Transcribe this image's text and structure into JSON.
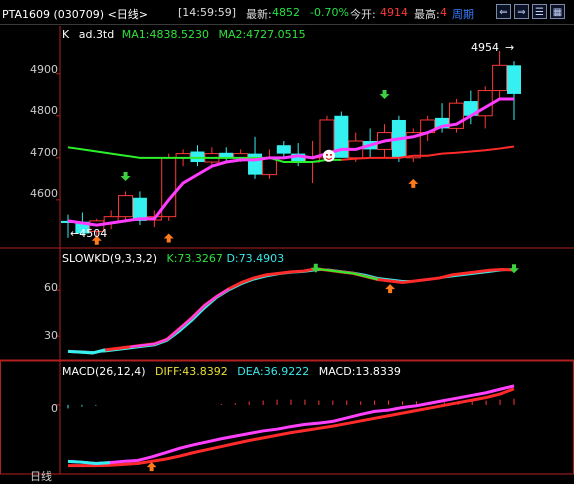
{
  "topbar": {
    "symbol": "PTA1609 (030709) <日线>",
    "clock": "[14:59:59]",
    "latest_label": "最新:",
    "latest_value": "4852",
    "change_pct": "-0.70%",
    "open_label": "今开:",
    "open_value": "4914",
    "high_label": "最高:",
    "high_value": "4",
    "cycle_label": "周期",
    "buttons": [
      {
        "name": "prev-button",
        "icon": "left-arrow-icon",
        "glyph": "⇐"
      },
      {
        "name": "next-button",
        "icon": "right-arrow-icon",
        "glyph": "⇒"
      },
      {
        "name": "list-button",
        "icon": "list-icon",
        "glyph": "☰"
      },
      {
        "name": "grid-button",
        "icon": "grid-icon",
        "glyph": "▦"
      }
    ]
  },
  "kline": {
    "header": {
      "prefix": "K",
      "name": "ad.3td",
      "ma1": "MA1:4838.5230",
      "ma2": "MA2:4727.0515"
    },
    "y_ticks": [
      "4900",
      "4800",
      "4700",
      "4600"
    ],
    "high_label": "4954",
    "low_label": "4504",
    "colors": {
      "up": "#ff3838",
      "down": "#34f0f0",
      "ma1": "#ff3cff",
      "ma2": "#2cf02c",
      "line": "#ff2a2a"
    }
  },
  "kd": {
    "header": {
      "name": "SLOWKD(9,3,3,2)",
      "k": "K:73.3267",
      "d": "D:73.4903"
    },
    "y_ticks": [
      "60",
      "30"
    ]
  },
  "macd": {
    "header": {
      "name": "MACD(26,12,4)",
      "diff": "DIFF:43.8392",
      "dea": "DEA:36.9222",
      "macd": "MACD:13.8339"
    },
    "y_ticks": [
      "0"
    ]
  },
  "bottom": {
    "period": "日线"
  },
  "chart_data": [
    {
      "type": "candlestick",
      "title": "PTA1609 K ad.3td",
      "ylim": [
        4495,
        4985
      ],
      "series": [
        {
          "name": "K",
          "ohlc": [
            [
              4550,
              4565,
              4510,
              4545
            ],
            [
              4548,
              4570,
              4515,
              4520
            ],
            [
              4525,
              4555,
              4505,
              4550
            ],
            [
              4545,
              4575,
              4530,
              4560
            ],
            [
              4560,
              4620,
              4550,
              4610
            ],
            [
              4605,
              4620,
              4540,
              4550
            ],
            [
              4552,
              4575,
              4535,
              4560
            ],
            [
              4560,
              4710,
              4550,
              4700
            ],
            [
              4700,
              4720,
              4680,
              4710
            ],
            [
              4715,
              4730,
              4680,
              4690
            ],
            [
              4690,
              4725,
              4680,
              4710
            ],
            [
              4712,
              4725,
              4690,
              4700
            ],
            [
              4700,
              4720,
              4690,
              4710
            ],
            [
              4710,
              4750,
              4650,
              4660
            ],
            [
              4660,
              4720,
              4650,
              4700
            ],
            [
              4730,
              4740,
              4700,
              4710
            ],
            [
              4710,
              4735,
              4680,
              4690
            ],
            [
              4690,
              4740,
              4640,
              4700
            ],
            [
              4700,
              4800,
              4690,
              4790
            ],
            [
              4800,
              4810,
              4700,
              4700
            ],
            [
              4700,
              4760,
              4690,
              4740
            ],
            [
              4740,
              4770,
              4700,
              4720
            ],
            [
              4720,
              4780,
              4700,
              4760
            ],
            [
              4790,
              4800,
              4690,
              4700
            ],
            [
              4700,
              4770,
              4690,
              4760
            ],
            [
              4760,
              4800,
              4740,
              4790
            ],
            [
              4795,
              4830,
              4760,
              4770
            ],
            [
              4770,
              4840,
              4760,
              4830
            ],
            [
              4835,
              4860,
              4780,
              4800
            ],
            [
              4800,
              4870,
              4770,
              4860
            ],
            [
              4860,
              4954,
              4840,
              4920
            ],
            [
              4920,
              4930,
              4790,
              4852
            ]
          ]
        },
        {
          "name": "MA1",
          "values": [
            4550,
            4545,
            4540,
            4545,
            4550,
            4555,
            4555,
            4600,
            4640,
            4660,
            4680,
            4690,
            4695,
            4695,
            4700,
            4700,
            4705,
            4700,
            4710,
            4720,
            4720,
            4730,
            4740,
            4745,
            4750,
            4760,
            4775,
            4780,
            4800,
            4820,
            4840,
            4840
          ]
        },
        {
          "name": "MA2",
          "values": [
            4725,
            4720,
            4715,
            4710,
            4705,
            4700,
            4700,
            4700,
            4700,
            4700,
            4700,
            4700,
            4700,
            4700,
            4700,
            4690,
            4690,
            4690,
            4695,
            4695,
            4698,
            4700,
            4700,
            4700,
            4705,
            4705,
            4710,
            4712,
            4715,
            4718,
            4722,
            4727
          ]
        }
      ]
    },
    {
      "type": "line",
      "title": "SLOWKD(9,3,3,2)",
      "ylim": [
        17,
        83
      ],
      "series": [
        {
          "name": "K",
          "values": [
            20,
            19.5,
            19,
            21,
            22,
            23,
            24,
            25,
            28,
            35,
            42,
            50,
            56,
            61,
            65,
            68,
            70,
            71,
            72,
            72.5,
            74,
            73,
            72,
            71,
            69,
            67,
            66,
            65,
            66,
            67,
            68,
            70,
            71,
            72,
            73,
            73.5,
            73.3
          ]
        },
        {
          "name": "D",
          "values": [
            20,
            20,
            19.5,
            20,
            21,
            22,
            23,
            24,
            27,
            33,
            40,
            48,
            55,
            60,
            64,
            67,
            69,
            70.5,
            71.5,
            72,
            73,
            73.5,
            72.5,
            71.5,
            70,
            68,
            67,
            66,
            66,
            67,
            68,
            69,
            70,
            71,
            72,
            73,
            73.5
          ]
        }
      ]
    },
    {
      "type": "bar+line",
      "title": "MACD(26,12,4)",
      "ylim": [
        -150,
        55
      ],
      "series": [
        {
          "name": "DIFF",
          "values": [
            -130,
            -132,
            -135,
            -133,
            -130,
            -128,
            -120,
            -110,
            -100,
            -92,
            -85,
            -78,
            -72,
            -66,
            -60,
            -56,
            -50,
            -45,
            -42,
            -38,
            -30,
            -22,
            -15,
            -12,
            -6,
            -2,
            4,
            10,
            16,
            22,
            28,
            36,
            44
          ]
        },
        {
          "name": "DEA",
          "values": [
            -140,
            -140,
            -140,
            -139,
            -137,
            -135,
            -130,
            -125,
            -118,
            -110,
            -103,
            -96,
            -89,
            -82,
            -76,
            -70,
            -64,
            -59,
            -54,
            -49,
            -43,
            -37,
            -31,
            -25,
            -19,
            -13,
            -7,
            -1,
            5,
            11,
            17,
            25,
            37
          ]
        },
        {
          "name": "MACD",
          "values": [
            -8,
            -4,
            -2,
            0,
            0,
            0,
            0,
            0,
            0,
            0,
            0,
            2,
            4,
            8,
            10,
            12,
            12,
            12,
            10,
            10,
            10,
            8,
            10,
            10,
            8,
            8,
            6,
            6,
            8,
            10,
            10,
            12,
            14
          ]
        }
      ]
    }
  ]
}
